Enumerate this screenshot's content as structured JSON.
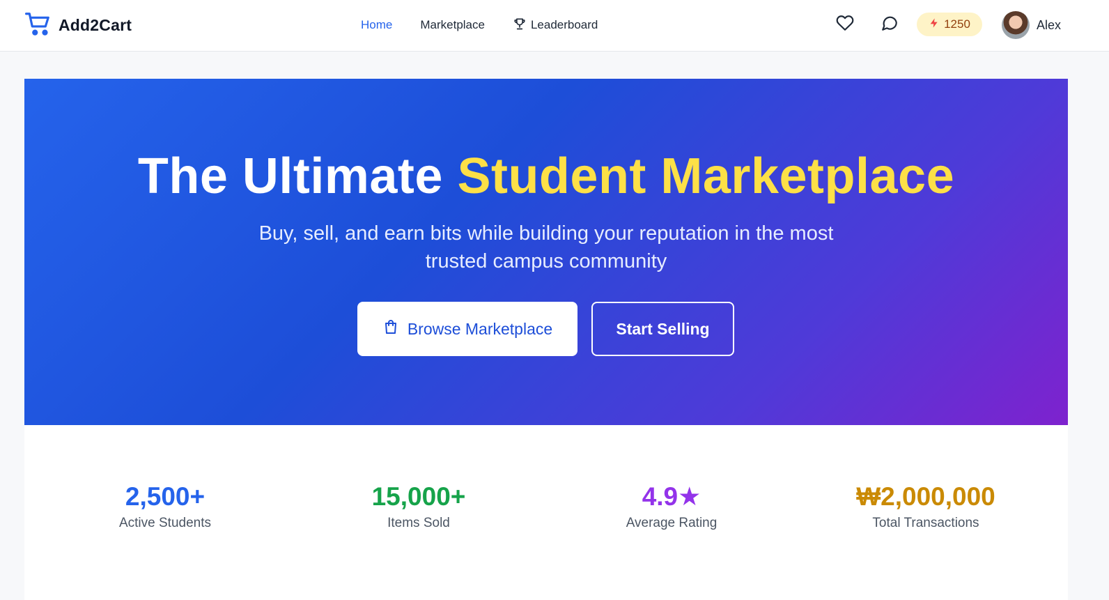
{
  "header": {
    "brand": "Add2Cart",
    "nav": {
      "home": "Home",
      "marketplace": "Marketplace",
      "leaderboard": "Leaderboard"
    },
    "bits": "1250",
    "username": "Alex"
  },
  "hero": {
    "title_part1": "The Ultimate ",
    "title_highlight": "Student Marketplace",
    "subtitle": "Buy, sell, and earn bits while building your reputation in the most trusted campus community",
    "browse_label": "Browse Marketplace",
    "sell_label": "Start Selling"
  },
  "stats": [
    {
      "value": "2,500+",
      "label": "Active Students",
      "color": "#2563eb"
    },
    {
      "value": "15,000+",
      "label": "Items Sold",
      "color": "#16a34a"
    },
    {
      "value": "4.9★",
      "label": "Average Rating",
      "color": "#9333ea"
    },
    {
      "value": "₩2,000,000",
      "label": "Total Transactions",
      "color": "#ca8a04"
    }
  ],
  "icons": [
    "cart-icon",
    "trophy-icon",
    "heart-icon",
    "chat-icon",
    "bolt-icon",
    "shopping-bag-icon"
  ],
  "colors": {
    "accent": "#2563eb",
    "highlight": "#fde047",
    "bits_bg": "#fef3c7"
  }
}
